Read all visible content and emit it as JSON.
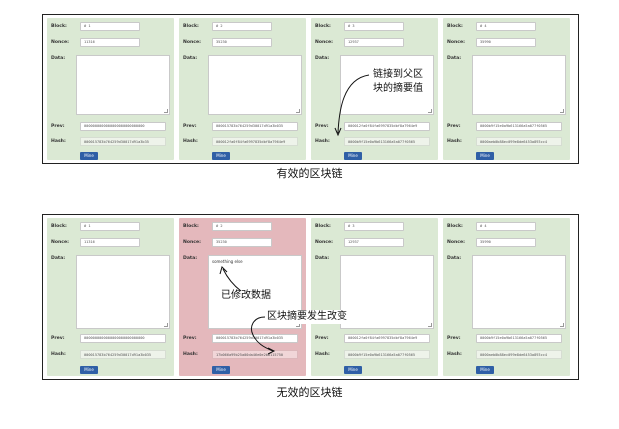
{
  "labels": {
    "block": "Block:",
    "nonce": "Nonce:",
    "data": "Data:",
    "prev": "Prev:",
    "hash": "Hash:",
    "mine": "Mine"
  },
  "valid": {
    "caption": "有效的区块链",
    "annotation": "链接到父区\n块的摘要值",
    "blocks": [
      {
        "block": "# 1",
        "nonce": "11316",
        "data": "",
        "prev": "0000000000000000000000000000",
        "hash": "000015783b764259d30017d91a3b35"
      },
      {
        "block": "# 2",
        "nonce": "35230",
        "data": "",
        "prev": "000015783b764259d30017d91a3b035",
        "hash": "000012fa0f84fa6997835dbf8a7964e9"
      },
      {
        "block": "# 3",
        "nonce": "12937",
        "data": "",
        "prev": "000012fa0f84fa6997835dbf8a7964e9",
        "hash": "0000b9f15e0a9b613166a5a077f0565"
      },
      {
        "block": "# 4",
        "nonce": "35990",
        "data": "",
        "prev": "0000b9f15e0a9b613166a5a077f0565",
        "hash": "0000aeb0b88ec099e8de6453a893cc4"
      }
    ]
  },
  "invalid": {
    "caption": "无效的区块链",
    "annotation_data": "已修改数据",
    "annotation_hash": "区块摘要发生改变",
    "blocks": [
      {
        "block": "# 1",
        "nonce": "11316",
        "data": "",
        "prev": "0000000000000000000000000000",
        "hash": "000015783b764259d30017d91a3b035"
      },
      {
        "block": "# 2",
        "nonce": "35230",
        "data": "something else",
        "prev": "000015783b764259d30017d91a3b035",
        "hash": "17b066a99b25a00da46e0e2b8115750"
      },
      {
        "block": "# 3",
        "nonce": "12937",
        "data": "",
        "prev": "000012fa0f84fa6997835dbf8a7964e9",
        "hash": "0000b9f15e0a9b613166a5a077f0565"
      },
      {
        "block": "# 4",
        "nonce": "35990",
        "data": "",
        "prev": "0000b9f15e0a9b613166a5a077f0565",
        "hash": "0000aeb0b88ec099e8de6453a893cc4"
      }
    ]
  }
}
